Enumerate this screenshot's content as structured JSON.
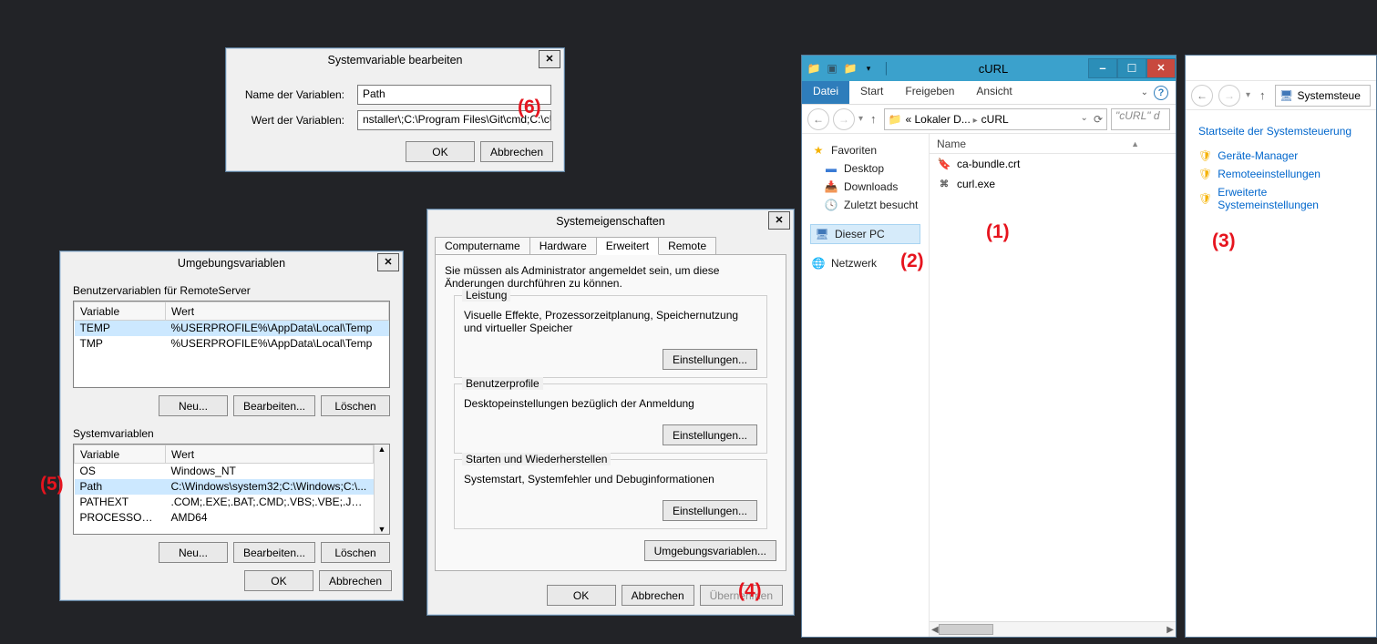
{
  "edit_var": {
    "title": "Systemvariable bearbeiten",
    "name_label": "Name der Variablen:",
    "value_label": "Wert der Variablen:",
    "name_value": "Path",
    "value_value": "nstaller\\;C:\\Program Files\\Git\\cmd;C:\\cURL",
    "ok": "OK",
    "cancel": "Abbrechen"
  },
  "env": {
    "title": "Umgebungsvariablen",
    "user_section": "Benutzervariablen für RemoteServer",
    "col_var": "Variable",
    "col_val": "Wert",
    "user_rows": [
      {
        "var": "TEMP",
        "val": "%USERPROFILE%\\AppData\\Local\\Temp"
      },
      {
        "var": "TMP",
        "val": "%USERPROFILE%\\AppData\\Local\\Temp"
      }
    ],
    "sys_section": "Systemvariablen",
    "sys_rows": [
      {
        "var": "OS",
        "val": "Windows_NT"
      },
      {
        "var": "Path",
        "val": "C:\\Windows\\system32;C:\\Windows;C:\\..."
      },
      {
        "var": "PATHEXT",
        "val": ".COM;.EXE;.BAT;.CMD;.VBS;.VBE;.JS;..."
      },
      {
        "var": "PROCESSOR_A...",
        "val": "AMD64"
      }
    ],
    "new": "Neu...",
    "edit": "Bearbeiten...",
    "del": "Löschen",
    "ok": "OK",
    "cancel": "Abbrechen"
  },
  "sysprops": {
    "title": "Systemeigenschaften",
    "tabs": [
      "Computername",
      "Hardware",
      "Erweitert",
      "Remote"
    ],
    "active_tab": 2,
    "admin_note": "Sie müssen als Administrator angemeldet sein, um diese Änderungen durchführen zu können.",
    "perf_title": "Leistung",
    "perf_text": "Visuelle Effekte, Prozessorzeitplanung, Speichernutzung und virtueller Speicher",
    "settings": "Einstellungen...",
    "profiles_title": "Benutzerprofile",
    "profiles_text": "Desktopeinstellungen bezüglich der Anmeldung",
    "startup_title": "Starten und Wiederherstellen",
    "startup_text": "Systemstart, Systemfehler und Debuginformationen",
    "envvars": "Umgebungsvariablen...",
    "ok": "OK",
    "cancel": "Abbrechen",
    "apply": "Übernehmen"
  },
  "explorer": {
    "title": "cURL",
    "ribbon": {
      "file": "Datei",
      "tabs": [
        "Start",
        "Freigeben",
        "Ansicht"
      ]
    },
    "breadcrumb_prefix": "« Lokaler D...",
    "breadcrumb_leaf": "cURL",
    "search_placeholder": "\"cURL\" d",
    "col_name": "Name",
    "side": {
      "fav": "Favoriten",
      "fav_items": [
        "Desktop",
        "Downloads",
        "Zuletzt besucht"
      ],
      "this_pc": "Dieser PC",
      "network": "Netzwerk"
    },
    "files": [
      {
        "icon": "cert-icon",
        "name": "ca-bundle.crt"
      },
      {
        "icon": "exe-icon",
        "name": "curl.exe"
      }
    ]
  },
  "cpanel": {
    "crumb": "Systemsteue",
    "heading": "Startseite der Systemsteuerung",
    "links": [
      "Geräte-Manager",
      "Remoteeinstellungen",
      "Erweiterte Systemeinstellungen"
    ]
  },
  "annotations": {
    "a1": "(1)",
    "a2": "(2)",
    "a3": "(3)",
    "a4": "(4)",
    "a5": "(5)",
    "a6": "(6)"
  }
}
